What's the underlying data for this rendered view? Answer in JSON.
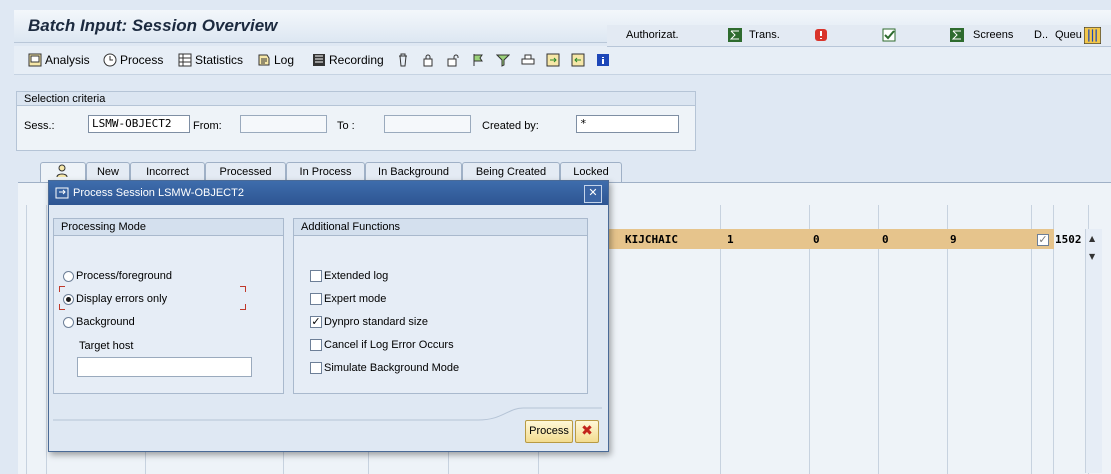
{
  "window": {
    "title": "Batch Input: Session Overview"
  },
  "toolbar": {
    "analysis": "Analysis",
    "process": "Process",
    "statistics": "Statistics",
    "log": "Log",
    "recording": "Recording",
    "icons": [
      "delete-icon",
      "lock-icon",
      "unlock-icon",
      "flag-icon",
      "filter-icon",
      "print-icon",
      "export-icon",
      "import-icon",
      "info-icon"
    ]
  },
  "selection": {
    "legend": "Selection criteria",
    "sess_label": "Sess.:",
    "sess_value": "LSMW-OBJECT2",
    "from_label": "From:",
    "from_value": "",
    "to_label": "To :",
    "to_value": "",
    "created_by_label": "Created by:",
    "created_by_value": "*"
  },
  "tabs": [
    "New",
    "Incorrect",
    "Processed",
    "In Process",
    "In Background",
    "Being Created",
    "Locked"
  ],
  "grid": {
    "headers": {
      "authorizat": "Authorizat.",
      "trans": "Trans.",
      "screens": "Screens",
      "d": "D..",
      "queue": "Queu"
    },
    "row": {
      "authorizat": "KIJCHAIC",
      "trans": "1",
      "errors": "0",
      "processed": "0",
      "screens": "9",
      "queue": "1502"
    }
  },
  "dialog": {
    "title": "Process Session LSMW-OBJECT2",
    "processing_mode": {
      "title": "Processing Mode",
      "options": [
        "Process/foreground",
        "Display errors only",
        "Background"
      ],
      "selected": "Display errors only",
      "target_host_label": "Target host",
      "target_host_value": ""
    },
    "additional": {
      "title": "Additional Functions",
      "options": [
        "Extended log",
        "Expert mode",
        "Dynpro standard size",
        "Cancel if Log Error Occurs",
        "Simulate Background Mode"
      ],
      "checked": [
        "Dynpro standard size"
      ]
    },
    "process_button": "Process"
  },
  "colors": {
    "row_highlight": "#e6c48c",
    "dialog_title": "#2d5592",
    "button": "#f3dc8f"
  }
}
